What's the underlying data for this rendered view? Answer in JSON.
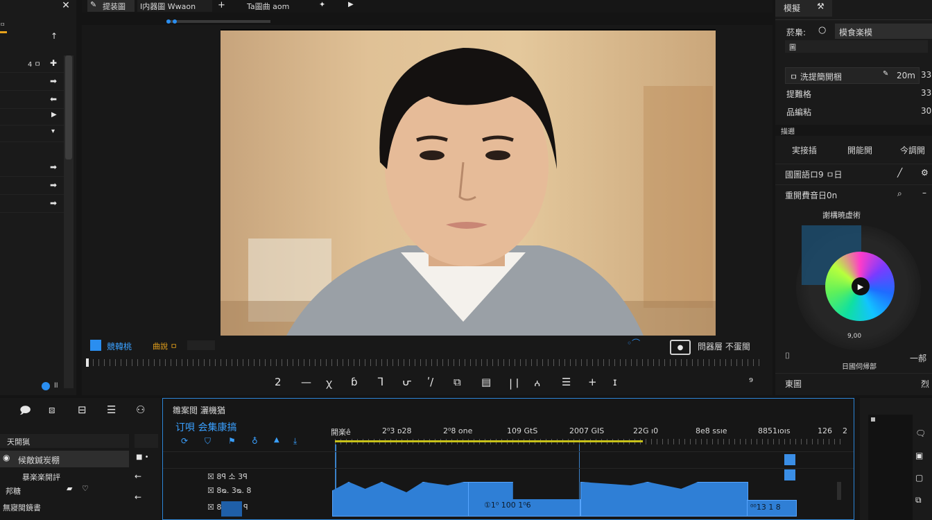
{
  "left_panel": {
    "header_small": "ㅁ",
    "rows": [
      {
        "icon": "arrow-up-icon",
        "text": ""
      },
      {
        "icon": "plus-icon",
        "text": "4 ㅁ"
      },
      {
        "icon": "arrow-right-icon",
        "text": ""
      },
      {
        "icon": "arrow-left-icon",
        "text": ""
      },
      {
        "icon": "play-small-icon",
        "text": ""
      },
      {
        "icon": "chevron-down-icon",
        "text": ""
      },
      {
        "icon": "arrow-right-icon",
        "text": ""
      },
      {
        "icon": "arrow-right-icon",
        "text": ""
      },
      {
        "icon": "arrow-right-icon",
        "text": ""
      }
    ],
    "footer_text": "ll"
  },
  "top_tabs": {
    "tab1": "提装圖",
    "tab2": "I内器圖 Wwaon",
    "tab3": "Ta圖曲 aom"
  },
  "preview": {
    "left_label": "競韓桃",
    "left_status": "曲說 ㅁ",
    "right_label": "問器層 不蛋閩",
    "toolbar_glyphs": [
      "2",
      "—",
      "ꭓ",
      "ɓ",
      "ᒣ",
      "ᕂ",
      "ʹ/",
      "⧉",
      "▤",
      "|ㅣ",
      "ꭅ",
      "☰",
      "+",
      "ɪ",
      "⁹"
    ]
  },
  "right_panel": {
    "tab": "模擬",
    "field1_label": "菸梟:",
    "field1_value": "模食楽模",
    "field2_value": "圖",
    "row_a_label": "ㅁ 洗提簡開梱",
    "row_a_value": "20m",
    "row_a_num": "33",
    "row_b_label": "提難格",
    "row_b_num": "33",
    "row_c_label": "品編粘",
    "row_c_num": "30",
    "section_small": "描遡",
    "col1": "実接插",
    "col2": "開能開",
    "col3": "今調開",
    "line1": "國圖語ロ9 ㅁ日",
    "line2": "重開費音日0n",
    "wheel_title": "謝構暁虚術",
    "wheel_value": "9,00",
    "wheel_footer": "日國伺帰部",
    "side_text": "一郝",
    "bottom_label": "東圖",
    "bottom_right": "烈"
  },
  "bottom_left": {
    "tool_icons": [
      "comment-icon",
      "split-icon",
      "layers-icon",
      "list-icon",
      "grid-icon"
    ],
    "header": "天開猟",
    "item_selected": "候敵鍼炭棚",
    "item2": "暴楽楽開評",
    "item3": "邦糖",
    "item4": "無寢閩鏡書"
  },
  "timeline": {
    "title": "雛案閲 灑機猶",
    "subtitle": "订唄 会集康搞",
    "ruler_labels": [
      "開楽ê",
      "2⁰3 ᴅ28",
      "2⁰8 one",
      "109 GtS",
      "2007 GIS",
      "22G ı0",
      "8e8 ssıe",
      "8851ıoıs",
      "126"
    ],
    "ruler_left_num": "2",
    "clip_text_a": "①1⁰ 100 1⁰6",
    "clip_text_b": "⁰⁰13 1 8",
    "track_labels": [
      "☒ 8ꟼ 소 3ꟼ",
      "☒ 8ᴓ. 3ᴓ. 8",
      "☒ 8ꟼ 8 ᴓ ꟼ"
    ]
  },
  "colors": {
    "accent_blue": "#2f7fd6",
    "accent_orange": "#e7a21b",
    "timeline_line_yellow": "#c8c21a"
  }
}
